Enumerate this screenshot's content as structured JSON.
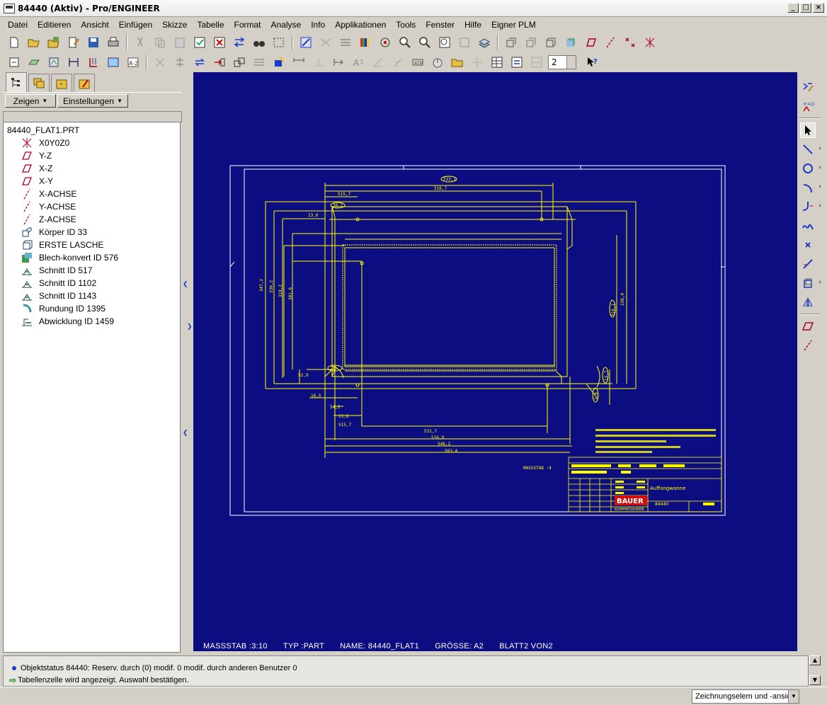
{
  "window": {
    "title": "84440 (Aktiv) - Pro/ENGINEER",
    "min_label": "_",
    "max_label": "□",
    "close_label": "×"
  },
  "menu": [
    "Datei",
    "Editieren",
    "Ansicht",
    "Einfügen",
    "Skizze",
    "Tabelle",
    "Format",
    "Analyse",
    "Info",
    "Applikationen",
    "Tools",
    "Fenster",
    "Hilfe",
    "Eigner PLM"
  ],
  "toolbar": {
    "scale_value": "2"
  },
  "panel": {
    "show_button": "Zeigen",
    "settings_button": "Einstellungen",
    "root": "84440_FLAT1.PRT",
    "items": [
      {
        "label": "X0Y0Z0",
        "icon": "coordinate-system-icon"
      },
      {
        "label": "Y-Z",
        "icon": "datum-plane-icon"
      },
      {
        "label": "X-Z",
        "icon": "datum-plane-icon"
      },
      {
        "label": "X-Y",
        "icon": "datum-plane-icon"
      },
      {
        "label": "X-ACHSE",
        "icon": "datum-axis-icon"
      },
      {
        "label": "Y-ACHSE",
        "icon": "datum-axis-icon"
      },
      {
        "label": "Z-ACHSE",
        "icon": "datum-axis-icon"
      },
      {
        "label": "Körper ID 33",
        "icon": "body-icon"
      },
      {
        "label": "ERSTE LASCHE",
        "icon": "wall-icon"
      },
      {
        "label": "Blech-konvert ID 576",
        "icon": "sheetmetal-convert-icon"
      },
      {
        "label": "Schnitt ID 517",
        "icon": "cut-icon"
      },
      {
        "label": "Schnitt ID 1102",
        "icon": "cut-icon"
      },
      {
        "label": "Schnitt ID 1143",
        "icon": "cut-icon"
      },
      {
        "label": "Rundung ID 1395",
        "icon": "round-icon"
      },
      {
        "label": "Abwicklung ID 1459",
        "icon": "flatten-icon"
      }
    ]
  },
  "drawing": {
    "footer": {
      "scale": "MASSSTAB :3:10",
      "type": "TYP :PART",
      "name": "NAME: 84440_FLAT1",
      "size": "GRÖSSE: A2",
      "sheet": "BLATT2  VON2"
    },
    "detail_scale": "MASSSTAB :4",
    "titleblock_name": "Auffangwanne",
    "titleblock_number": "84440",
    "company": "BAUER",
    "company_sub": "KOMPRESSOREN",
    "dims": {
      "top1": "522,1",
      "top2": "516,7",
      "top3": "515,7",
      "left1": "13,6",
      "mid_left": "13,6",
      "bottom1": "531,7",
      "bottom2": "516,9",
      "bottom3": "546,2",
      "bottom4": "563,4",
      "right1": "316,1",
      "right2": "336,4",
      "side1": "347,2",
      "side2": "330,2",
      "side3": "319,2",
      "side4": "301,6",
      "small1": "36,1",
      "small2": "54,2",
      "small3": "16,5",
      "small4": "52,9",
      "r1": "13,7",
      "r2": "2,8"
    },
    "colors": {
      "background": "#0d0d82",
      "lines": "#ffff00",
      "frame": "#ffffff",
      "logo": "#d01010"
    }
  },
  "messages": [
    {
      "text": "Objektstatus 84440:  Reserv. durch (0) modif. 0 modif. durch anderen Benutzer 0",
      "icon": "info-dot-icon"
    },
    {
      "text": "Tabellenzelle wird angezeigt. Auswahl bestätigen.",
      "icon": "arrow-right-icon"
    }
  ],
  "status": {
    "filter": "Zeichnungselem und -ansic"
  }
}
